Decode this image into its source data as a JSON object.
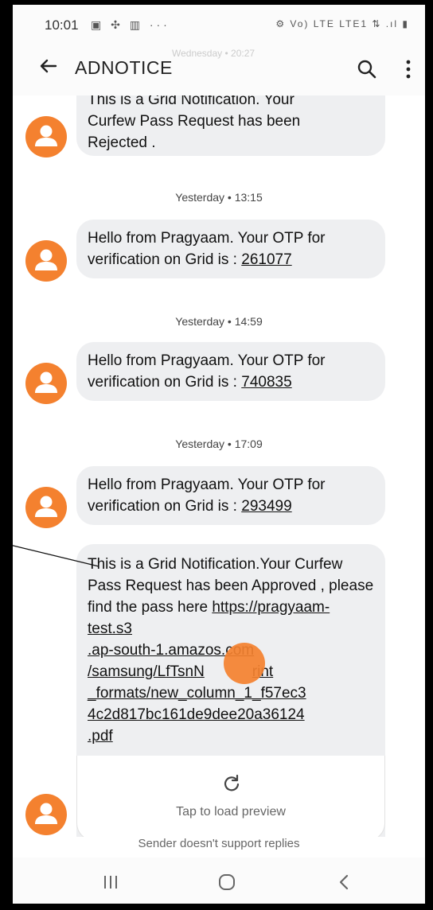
{
  "status": {
    "time": "10:01",
    "left_icons": "▣ ✣ ▥ ···",
    "right_icons": "⚙ Vo) LTE LTE1 ⇅ .ıl ▮"
  },
  "appbar": {
    "title": "ADNOTICE",
    "ghost_date": "Wednesday • 20:27"
  },
  "messages": [
    {
      "text_lines": [
        "This is a Grid Notification. Your",
        "Curfew Pass Request has been",
        "Rejected ."
      ]
    },
    {
      "timestamp": "Yesterday • 13:15",
      "prefix": "Hello from Pragyaam. Your OTP for verification on Grid is : ",
      "otp": "261077"
    },
    {
      "timestamp": "Yesterday • 14:59",
      "prefix": "Hello from Pragyaam. Your OTP for verification on Grid is : ",
      "otp": "740835"
    },
    {
      "timestamp": "Yesterday • 17:09",
      "prefix": "Hello from Pragyaam. Your OTP for verification on Grid is : ",
      "otp": "293499"
    },
    {
      "text": "This is a Grid Notification.Your Curfew Pass Request has been Approved , please find the pass here ",
      "link": "https://pragyaam-test.s3.ap-south-1.amazonaws.com/samsung/LfTsnN/print_formats/new_column_1_f57ec34c2d817bc161de9dee20a36124.pdf",
      "link_lines": [
        "https://pragyaam-test.s3",
        ".ap-south-1.amazo",
        "/samsung/LfTsnN",
        "_formats/new_column_1_f57ec3",
        "4c2d817bc161de9dee20a36124",
        ".pdf"
      ],
      "link_tails": [
        "",
        "s.com",
        "rint",
        "",
        "",
        ""
      ]
    }
  ],
  "preview": {
    "label": "Tap to load preview"
  },
  "reply_note": "Sender doesn't support replies",
  "colors": {
    "avatar": "#f4812f",
    "bubble": "#eeeff1"
  },
  "icons": {
    "back": "arrow-left-icon",
    "search": "search-icon",
    "more": "more-vert-icon",
    "reload": "reload-icon"
  }
}
